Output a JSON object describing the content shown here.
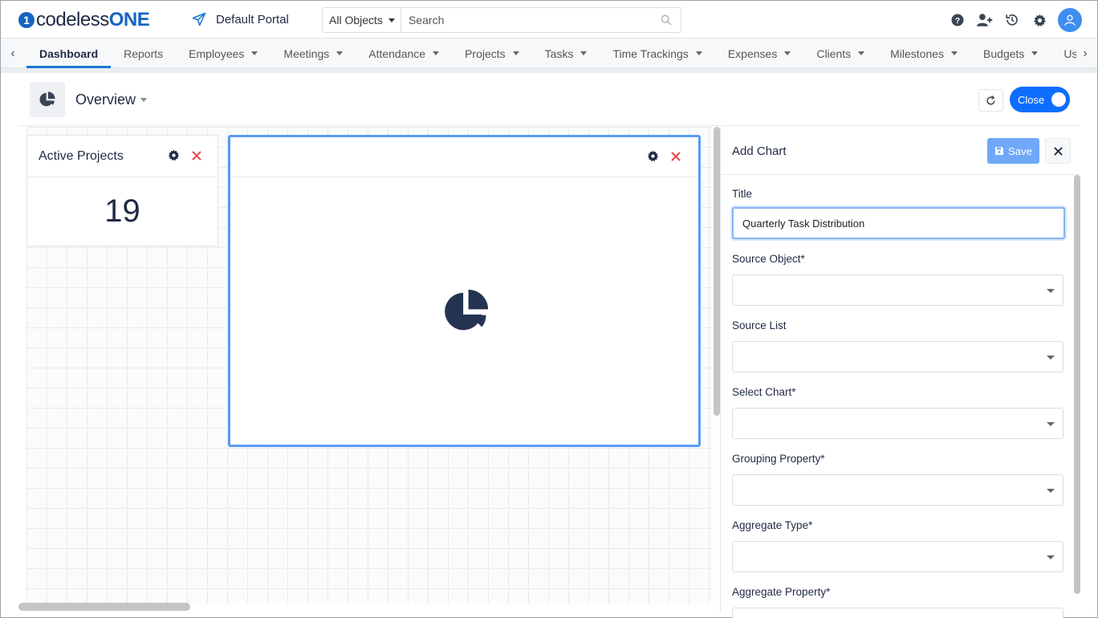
{
  "brand": {
    "logo_mark": "1",
    "name_prefix": "codeless",
    "name_suffix": "ONE"
  },
  "portal": {
    "label": "Default Portal",
    "icon": "paper-plane-icon"
  },
  "search": {
    "scope": "All Objects",
    "placeholder": "Search"
  },
  "top_icons": [
    "help-icon",
    "add-user-icon",
    "history-icon",
    "settings-icon",
    "user-avatar-icon"
  ],
  "nav": {
    "tabs": [
      {
        "label": "Dashboard",
        "active": true,
        "dropdown": false
      },
      {
        "label": "Reports",
        "dropdown": false
      },
      {
        "label": "Employees",
        "dropdown": true
      },
      {
        "label": "Meetings",
        "dropdown": true
      },
      {
        "label": "Attendance",
        "dropdown": true
      },
      {
        "label": "Projects",
        "dropdown": true
      },
      {
        "label": "Tasks",
        "dropdown": true
      },
      {
        "label": "Time Trackings",
        "dropdown": true
      },
      {
        "label": "Expenses",
        "dropdown": true
      },
      {
        "label": "Clients",
        "dropdown": true
      },
      {
        "label": "Milestones",
        "dropdown": true
      },
      {
        "label": "Budgets",
        "dropdown": true
      },
      {
        "label": "Us",
        "dropdown": false
      }
    ]
  },
  "overview": {
    "title": "Overview",
    "toggle_label": "Close"
  },
  "widgets": {
    "active_projects": {
      "title": "Active Projects",
      "value": "19"
    }
  },
  "panel": {
    "title": "Add Chart",
    "save_label": "Save",
    "title_label": "Title",
    "title_value": "Quarterly Task Distribution",
    "fields": [
      {
        "label": "Source Object*",
        "value": ""
      },
      {
        "label": "Source List",
        "value": ""
      },
      {
        "label": "Select Chart*",
        "value": ""
      },
      {
        "label": "Grouping Property*",
        "value": ""
      },
      {
        "label": "Aggregate Type*",
        "value": ""
      },
      {
        "label": "Aggregate Property*",
        "value": ""
      }
    ]
  },
  "colors": {
    "accent": "#1976d2",
    "toggle": "#0d6efd",
    "save": "#6fa8f7",
    "danger": "#e5484d",
    "text": "#1f2a44"
  }
}
